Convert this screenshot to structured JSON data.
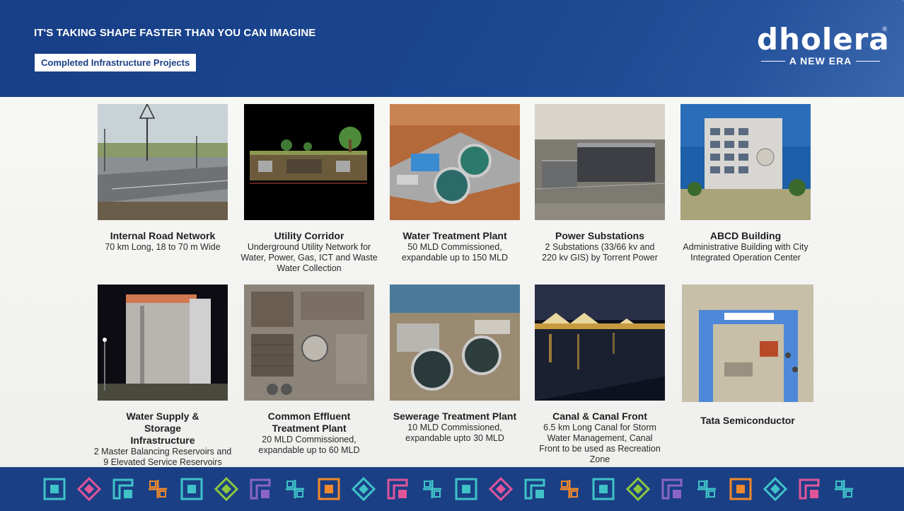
{
  "header": {
    "tagline": "IT'S TAKING SHAPE FASTER THAN YOU CAN IMAGINE",
    "section_label": "Completed Infrastructure Projects",
    "logo": {
      "word": "dholera",
      "reg": "®",
      "sub": "A NEW ERA"
    }
  },
  "projects": [
    {
      "title": "Internal Road Network",
      "desc": "70 km Long, 18 to 70 m Wide",
      "photo": "road-photo"
    },
    {
      "title": "Utility Corridor",
      "desc": "Underground Utility Network for Water, Power, Gas, ICT and Waste Water Collection",
      "photo": "utility-corridor-diagram"
    },
    {
      "title": "Water Treatment Plant",
      "desc": "50 MLD Commissioned, expandable up to 150 MLD",
      "photo": "water-plant-photo"
    },
    {
      "title": "Power Substations",
      "desc": "2 Substations (33/66 kv and 220 kv GIS) by Torrent Power",
      "photo": "substation-photo"
    },
    {
      "title": "ABCD Building",
      "desc": "Administrative Building with City Integrated Operation Center",
      "photo": "abcd-building-photo"
    },
    {
      "title": "Water Supply & Storage Infrastructure",
      "desc": "2 Master Balancing Reservoirs and 9 Elevated Service Reservoirs",
      "photo": "reservoir-photo"
    },
    {
      "title": "Common Effluent Treatment Plant",
      "desc": "20 MLD Commissioned, expandable up to 60 MLD",
      "photo": "cetp-photo"
    },
    {
      "title": "Sewerage Treatment Plant",
      "desc": "10 MLD Commissioned, expandable upto 30 MLD",
      "photo": "stp-photo"
    },
    {
      "title": "Canal & Canal Front",
      "desc": "6.5 km Long Canal for Storm Water Management, Canal Front to be used as Recreation Zone",
      "photo": "canal-photo"
    },
    {
      "title": "Tata Semiconductor",
      "desc": "",
      "photo": "tata-semiconductor-photo"
    }
  ],
  "footer_icons": [
    "pattern-icon"
  ],
  "colors": {
    "brand_blue": "#1b4690",
    "footer_blue": "#1a3f85",
    "icon_teal": "#3fc3c8",
    "icon_pink": "#e0559a",
    "icon_orange": "#f08a2c",
    "icon_green": "#8cc63f",
    "icon_purple": "#8a64c8"
  }
}
